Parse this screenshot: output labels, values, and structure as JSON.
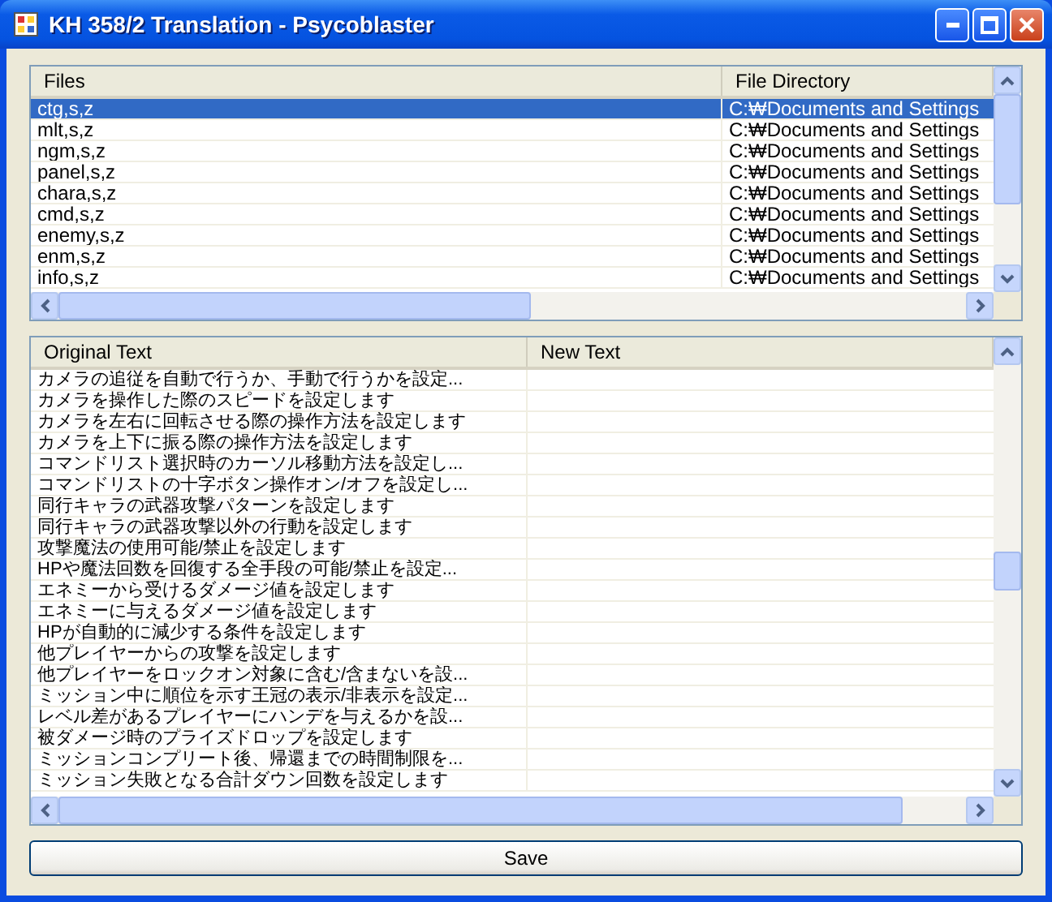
{
  "window": {
    "title": "KH 358/2 Translation - Psycoblaster"
  },
  "files_table": {
    "columns": [
      "Files",
      "File Directory"
    ],
    "rows": [
      {
        "file": "ctg,s,z",
        "directory": "C:₩Documents and Settings",
        "selected": true
      },
      {
        "file": "mlt,s,z",
        "directory": "C:₩Documents and Settings",
        "selected": false
      },
      {
        "file": "ngm,s,z",
        "directory": "C:₩Documents and Settings",
        "selected": false
      },
      {
        "file": "panel,s,z",
        "directory": "C:₩Documents and Settings",
        "selected": false
      },
      {
        "file": "chara,s,z",
        "directory": "C:₩Documents and Settings",
        "selected": false
      },
      {
        "file": "cmd,s,z",
        "directory": "C:₩Documents and Settings",
        "selected": false
      },
      {
        "file": "enemy,s,z",
        "directory": "C:₩Documents and Settings",
        "selected": false
      },
      {
        "file": "enm,s,z",
        "directory": "C:₩Documents and Settings",
        "selected": false
      },
      {
        "file": "info,s,z",
        "directory": "C:₩Documents and Settings",
        "selected": false
      }
    ]
  },
  "text_table": {
    "columns": [
      "Original Text",
      "New Text"
    ],
    "rows": [
      {
        "original": "カメラの追従を自動で行うか、手動で行うかを設定..."
      },
      {
        "original": "カメラを操作した際のスピードを設定します"
      },
      {
        "original": "カメラを左右に回転させる際の操作方法を設定します"
      },
      {
        "original": "カメラを上下に振る際の操作方法を設定します"
      },
      {
        "original": "コマンドリスト選択時のカーソル移動方法を設定し..."
      },
      {
        "original": "コマンドリストの十字ボタン操作オン/オフを設定し..."
      },
      {
        "original": "同行キャラの武器攻撃パターンを設定します"
      },
      {
        "original": "同行キャラの武器攻撃以外の行動を設定します"
      },
      {
        "original": "攻撃魔法の使用可能/禁止を設定します"
      },
      {
        "original": "HPや魔法回数を回復する全手段の可能/禁止を設定..."
      },
      {
        "original": "エネミーから受けるダメージ値を設定します"
      },
      {
        "original": "エネミーに与えるダメージ値を設定します"
      },
      {
        "original": "HPが自動的に減少する条件を設定します"
      },
      {
        "original": "他プレイヤーからの攻撃を設定します"
      },
      {
        "original": "他プレイヤーをロックオン対象に含む/含まないを設..."
      },
      {
        "original": "ミッション中に順位を示す王冠の表示/非表示を設定..."
      },
      {
        "original": "レベル差があるプレイヤーにハンデを与えるかを設..."
      },
      {
        "original": "被ダメージ時のプライズドロップを設定します"
      },
      {
        "original": "ミッションコンプリート後、帰還までの時間制限を..."
      },
      {
        "original": "ミッション失敗となる合計ダウン回数を設定します"
      }
    ]
  },
  "save_button": {
    "label": "Save"
  }
}
